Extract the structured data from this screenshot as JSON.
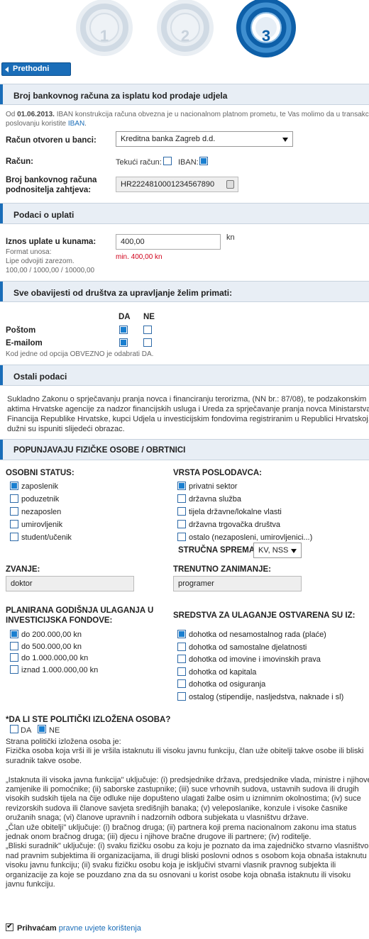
{
  "steps": [
    "1",
    "2",
    "3"
  ],
  "nav": {
    "back_label": "Prethodni korak"
  },
  "sec1": {
    "title": "Broj bankovnog računa za isplatu kod prodaje udjela",
    "note_prefix": "Od ",
    "note_date": "01.06.2013.",
    "note_text": " IBAN konstrukcija računa obvezna je u nacionalnom platnom prometu, te Vas molimo da u transakcijsko",
    "note_line2": "poslovanju koristite ",
    "note_iban": "IBAN",
    "note_dot": ".",
    "bank_label": "Račun otvoren u banci:",
    "bank_value": "Kreditna banka Zagreb d.d.",
    "account_label": "Račun:",
    "current_account_label": "Tekući račun:",
    "iban_label": "IBAN:",
    "current_checked": false,
    "iban_checked": true,
    "number_label_1": "Broj bankovnog računa",
    "number_label_2": "podnositelja zahtjeva:",
    "number_value": "HR2224810001234567890"
  },
  "sec2": {
    "title": "Podaci o uplati",
    "amount_label": "Iznos uplate u kunama:",
    "amount_value": "400,00",
    "currency": "kn",
    "min_text": "min. 400,00 kn",
    "format_1": "Format unosa:",
    "format_2": "Lipe odvojiti zarezom.",
    "format_3": "100,00 / 1000,00 / 10000,00"
  },
  "sec3": {
    "title": "Sve obavijesti od društva za upravljanje želim primati:",
    "yes": "DA",
    "no": "NE",
    "post_label": "Poštom",
    "email_label": "E-mailom",
    "post_yes": true,
    "email_yes": true,
    "note": "Kod jedne od opcija OBVEZNO je odabrati DA."
  },
  "sec4": {
    "title": "Ostali podaci",
    "text_1": "Sukladno Zakonu o sprječavanju pranja novca i financiranju terorizma, (NN br.: 87/08), te podzakonskim",
    "text_2": "aktima Hrvatske agencije za nadzor financijskih usluga i Ureda za sprječavanje pranja novca Ministarstva",
    "text_3": "Financija Republike Hrvatske, kupci Udjela u investicijskim fondovima registriranim u Republici Hrvatskoj,",
    "text_4": "dužni su ispuniti slijedeći obrazac."
  },
  "sec5": {
    "title": "POPUNJAVAJU FIZIČKE OSOBE / OBRTNICI",
    "status_title": "OSOBNI STATUS:",
    "status_options": [
      {
        "label": "zaposlenik",
        "checked": true
      },
      {
        "label": "poduzetnik",
        "checked": false
      },
      {
        "label": "nezaposlen",
        "checked": false
      },
      {
        "label": "umirovljenik",
        "checked": false
      },
      {
        "label": "student/učenik",
        "checked": false
      }
    ],
    "employer_title": "VRSTA POSLODAVCA:",
    "employer_options": [
      {
        "label": "privatni sektor",
        "checked": true
      },
      {
        "label": "državna služba",
        "checked": false
      },
      {
        "label": "tijela državne/lokalne vlasti",
        "checked": false
      },
      {
        "label": "državna trgovačka društva",
        "checked": false
      },
      {
        "label": "ostalo (nezaposleni, umirovljenici...)",
        "checked": false
      }
    ],
    "qualification_label": "STRUČNA SPREMA:",
    "qualification_value": "KV, NSS",
    "title_label": "ZVANJE:",
    "title_value": "doktor",
    "occupation_label": "TRENUTNO ZANIMANJE:",
    "occupation_value": "programer",
    "invest_title_1": "PLANIRANA GODIŠNJA ULAGANJA U",
    "invest_title_2": "INVESTICIJSKA FONDOVE:",
    "invest_options": [
      {
        "label": "do 200.000,00 kn",
        "checked": true
      },
      {
        "label": "do 500.000,00 kn",
        "checked": false
      },
      {
        "label": "do 1.000.000,00 kn",
        "checked": false
      },
      {
        "label": "iznad 1.000.000,00 kn",
        "checked": false
      }
    ],
    "funds_title": "SREDSTVA ZA ULAGANJE OSTVARENA SU IZ:",
    "funds_options": [
      {
        "label": "dohotka od nesamostalnog rada (plaće)",
        "checked": true
      },
      {
        "label": "dohotka od samostalne djelatnosti",
        "checked": false
      },
      {
        "label": "dohotka od imovine i imovinskih prava",
        "checked": false
      },
      {
        "label": "dohotka od kapitala",
        "checked": false
      },
      {
        "label": "dohotka od osiguranja",
        "checked": false
      },
      {
        "label": "ostalog (stipendije, nasljedstva, naknade i sl)",
        "checked": false
      }
    ],
    "pep_question": "*DA LI STE POLITIČKI IZLOŽENA OSOBA?",
    "pep_yes": "DA",
    "pep_no": "NE",
    "pep_yes_checked": false,
    "pep_no_checked": true,
    "pep_text": [
      "Strana politički izložena osoba je:",
      "Fizička osoba koja vrši ili je vršila istaknutu ili visoku javnu funkciju, član uže obitelji takve osobe ili bliski",
      "suradnik takve osobe.",
      "",
      "„Istaknuta ili visoka javna funkcija\" uključuje: (i) predsjednike država, predsjednike vlada, ministre i njihove",
      "zamjenike ili pomoćnike; (ii) saborske zastupnike; (iii) suce vrhovnih sudova, ustavnih sudova ili drugih",
      "visokih sudskih tijela na čije odluke nije dopušteno ulagati žalbe osim u iznimnim okolnostima; (iv) suce",
      "revizorskih sudova ili članove savjeta središnjih banaka; (v) veleposlanike, konzule i visoke časnike",
      "oružanih snaga; (vi) članove upravnih i nadzornih odbora subjekata u vlasništvu države.",
      "„Član uže obitelji\" uključuje: (i) bračnog druga; (ii) partnera koji prema nacionalnom zakonu ima status",
      "jednak onom bračnog druga; (iii) djecu i njihove bračne drugove ili partnere; (iv) roditelje.",
      "„Bliski suradnik\" uključuje: (i) svaku fizičku osobu za koju je poznato da ima zajedničko stvarno vlasništvo",
      "nad pravnim subjektima ili organizacijama, ili drugi bliski poslovni odnos s osobom koja obnaša istaknutu ili",
      "visoku javnu funkciju; (ii) svaku fizičku osobu koja je isključivi stvarni vlasnik pravnog subjekta ili",
      "organizacije za koje se pouzdano zna da su osnovani u korist osobe koja obnaša istaknutu ili visoku",
      "javnu funkciju."
    ],
    "accept_label": "Prihvaćam",
    "accept_link": "pravne uvjete korištenja"
  }
}
